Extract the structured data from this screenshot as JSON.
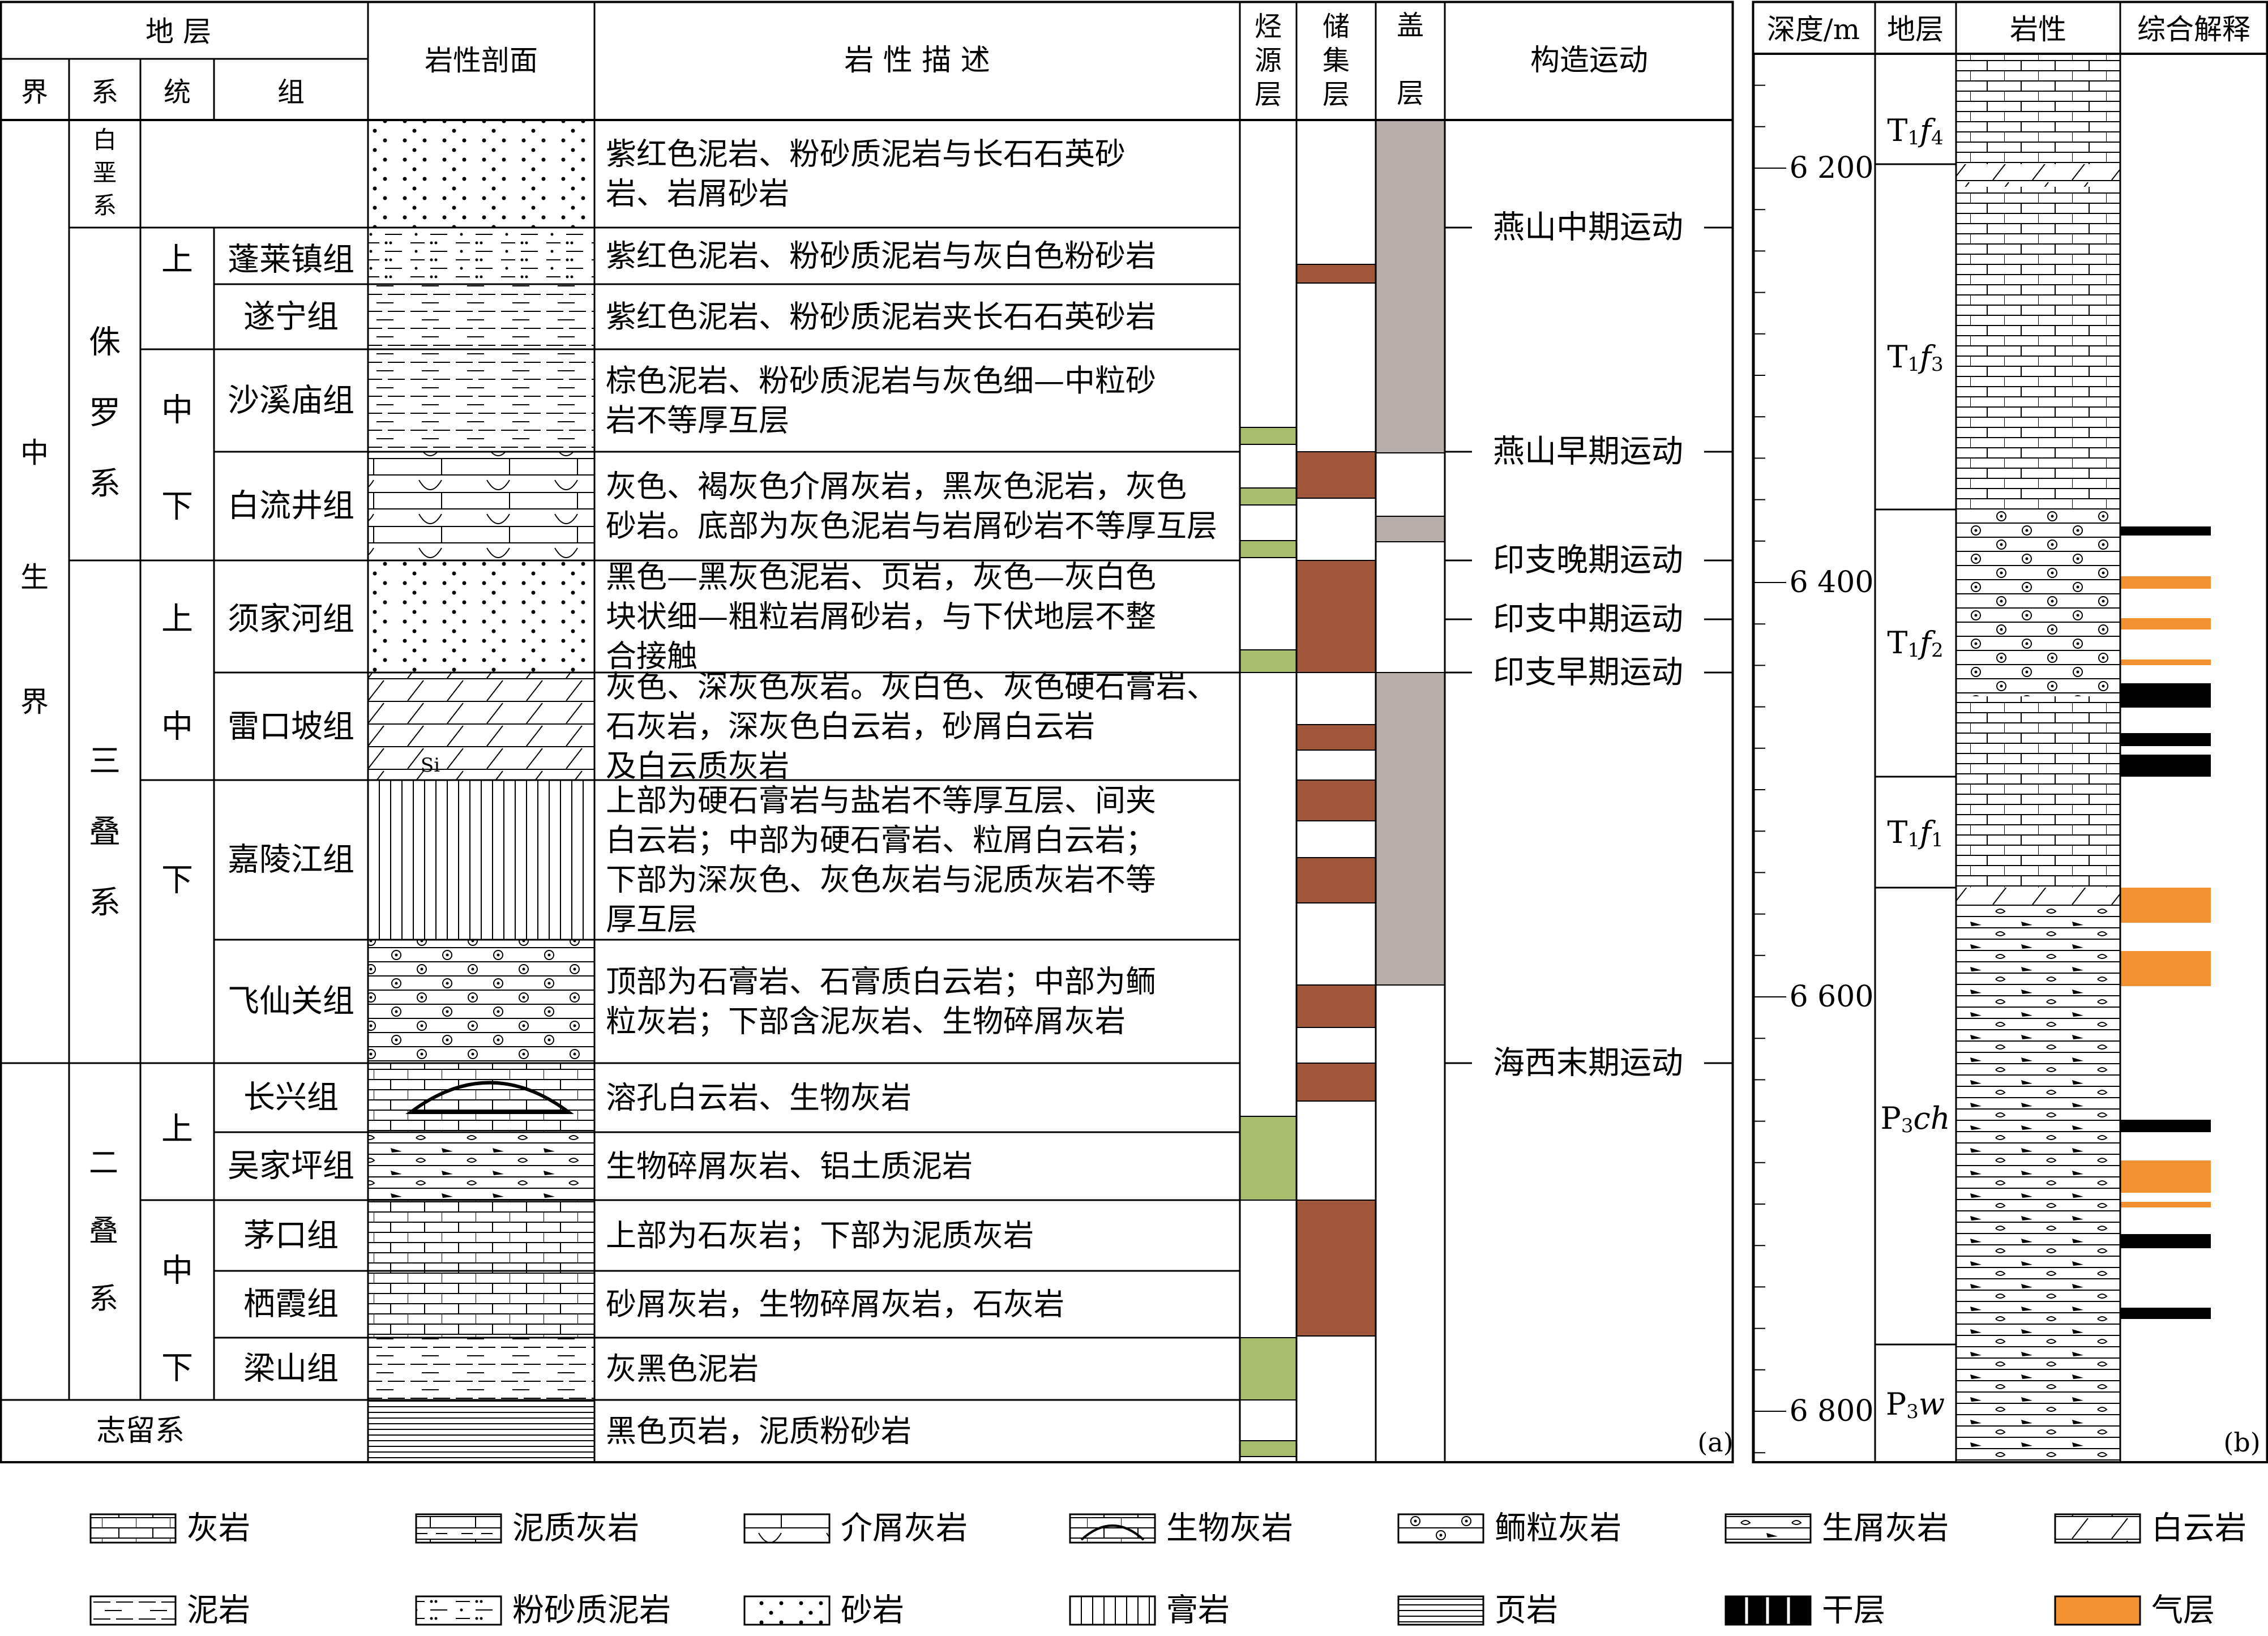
{
  "panel_a": {
    "header": {
      "strata": "地 层",
      "era": "界",
      "system": "系",
      "series": "统",
      "formation": "组",
      "profile": "岩性剖面",
      "desc": "岩 性 描 述",
      "source": [
        "烃",
        "源",
        "层"
      ],
      "reservoir": [
        "储",
        "集",
        "层"
      ],
      "cap": [
        "盖",
        "层"
      ],
      "tectonic": "构造运动"
    },
    "eras": [
      {
        "name": [
          "中",
          "生",
          "界"
        ]
      },
      {
        "name": [
          "二",
          "叠",
          "系"
        ]
      },
      {
        "name": [
          "志留系"
        ]
      }
    ],
    "systems": [
      {
        "name": [
          "白",
          "垩",
          "系"
        ]
      },
      {
        "name": [
          "侏",
          "罗",
          "系"
        ]
      },
      {
        "name": [
          "三",
          "叠",
          "系"
        ]
      },
      {
        "name": [
          "二",
          "叠",
          "系"
        ]
      }
    ],
    "series": [
      "上",
      "中",
      "下",
      "上",
      "中",
      "下",
      "上",
      "中",
      "下"
    ],
    "formations": [
      "蓬莱镇组",
      "遂宁组",
      "沙溪庙组",
      "白流井组",
      "须家河组",
      "雷口坡组",
      "嘉陵江组",
      "飞仙关组",
      "长兴组",
      "吴家坪组",
      "茅口组",
      "栖霞组",
      "梁山组"
    ],
    "descriptions": [
      [
        "紫红色泥岩、粉砂质泥岩与长石石英砂",
        "岩、岩屑砂岩"
      ],
      [
        "紫红色泥岩、粉砂质泥岩与灰白色粉砂岩"
      ],
      [
        "紫红色泥岩、粉砂质泥岩夹长石石英砂岩"
      ],
      [
        "棕色泥岩、粉砂质泥岩与灰色细—中粒砂",
        "岩不等厚互层"
      ],
      [
        "灰色、褐灰色介屑灰岩，黑灰色泥岩，灰色",
        "砂岩。底部为灰色泥岩与岩屑砂岩不等厚互层"
      ],
      [
        "黑色—黑灰色泥岩、页岩，灰色—灰白色",
        "块状细—粗粒岩屑砂岩，与下伏地层不整",
        "合接触"
      ],
      [
        "灰色、深灰色灰岩。灰白色、灰色硬石膏岩、",
        "石灰岩，深灰色白云岩，砂屑白云岩",
        "及白云质灰岩"
      ],
      [
        "上部为硬石膏岩与盐岩不等厚互层、间夹",
        "白云岩；中部为硬石膏岩、粒屑白云岩；",
        "下部为深灰色、灰色灰岩与泥质灰岩不等",
        "厚互层"
      ],
      [
        "顶部为石膏岩、石膏质白云岩；中部为鲕",
        "粒灰岩；下部含泥灰岩、生物碎屑灰岩"
      ],
      [
        "溶孔白云岩、生物灰岩"
      ],
      [
        "生物碎屑灰岩、铝土质泥岩"
      ],
      [
        "上部为石灰岩；下部为泥质灰岩"
      ],
      [
        "砂屑灰岩，生物碎屑灰岩，石灰岩"
      ],
      [
        "灰黑色泥岩"
      ],
      [
        "黑色页岩，泥质粉砂岩"
      ]
    ],
    "si_label": "Si",
    "tectonic_events": [
      "燕山中期运动",
      "燕山早期运动",
      "印支晚期运动",
      "印支中期运动",
      "印支早期运动",
      "海西末期运动"
    ],
    "panel_label": "(a)"
  },
  "panel_b": {
    "header": {
      "depth": "深度/m",
      "strata": "地层",
      "lithology": "岩性",
      "interp": "综合解释"
    },
    "depth_ticks": [
      "6 200",
      "6 400",
      "6 600",
      "6 800"
    ],
    "strata_labels": [
      {
        "base": "T",
        "sub": "1",
        "italic": "f",
        "sub2": "4"
      },
      {
        "base": "T",
        "sub": "1",
        "italic": "f",
        "sub2": "3"
      },
      {
        "base": "T",
        "sub": "1",
        "italic": "f",
        "sub2": "2"
      },
      {
        "base": "T",
        "sub": "1",
        "italic": "f",
        "sub2": "1"
      },
      {
        "base": "P",
        "sub": "3",
        "italic": "ch",
        "sub2": ""
      },
      {
        "base": "P",
        "sub": "3",
        "italic": "w",
        "sub2": ""
      }
    ],
    "panel_label": "(b)"
  },
  "colors": {
    "source": "#a9bd6f",
    "reservoir": "#a0563a",
    "cap": "#b7aeac",
    "gas": "#f29233",
    "dry": "#000000"
  },
  "legend": [
    "灰岩",
    "泥质灰岩",
    "介屑灰岩",
    "生物灰岩",
    "鲕粒灰岩",
    "生屑灰岩",
    "白云岩",
    "泥岩",
    "粉砂质泥岩",
    "砂岩",
    "膏岩",
    "页岩",
    "干层",
    "气层"
  ]
}
